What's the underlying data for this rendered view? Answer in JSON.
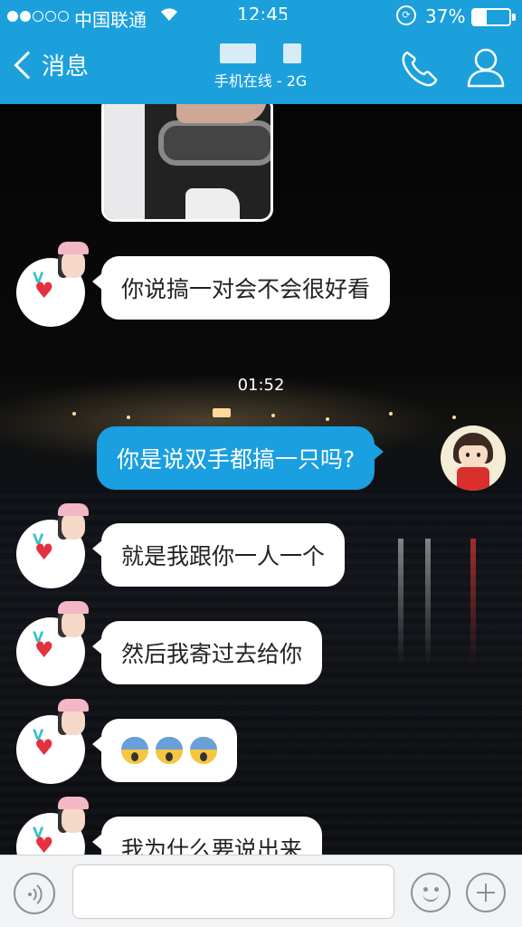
{
  "status_bar": {
    "carrier": "中国联通",
    "time": "12:45",
    "battery_percent": "37%",
    "battery_level": 0.37
  },
  "header": {
    "back_label": "消息",
    "contact_subtitle": "手机在线 - 2G",
    "icons": [
      "phone-icon",
      "profile-icon"
    ]
  },
  "messages": [
    {
      "side": "left",
      "type": "image"
    },
    {
      "side": "left",
      "type": "text",
      "text": "你说搞一对会不会很好看"
    },
    {
      "type": "timestamp",
      "text": "01:52"
    },
    {
      "side": "right",
      "type": "text",
      "text": "你是说双手都搞一只吗?"
    },
    {
      "side": "left",
      "type": "text",
      "text": "就是我跟你一人一个"
    },
    {
      "side": "left",
      "type": "text",
      "text": "然后我寄过去给你"
    },
    {
      "side": "left",
      "type": "emoji",
      "emoji_count": 3
    },
    {
      "side": "left",
      "type": "text",
      "text": "我为什么要说出来"
    }
  ],
  "input_bar": {
    "placeholder": "",
    "icons": [
      "voice-icon",
      "emoji-icon",
      "plus-icon"
    ]
  },
  "colors": {
    "header_bg": "#1ba0dc",
    "bubble_right": "#1a9fe0",
    "bubble_left": "#ffffff"
  }
}
